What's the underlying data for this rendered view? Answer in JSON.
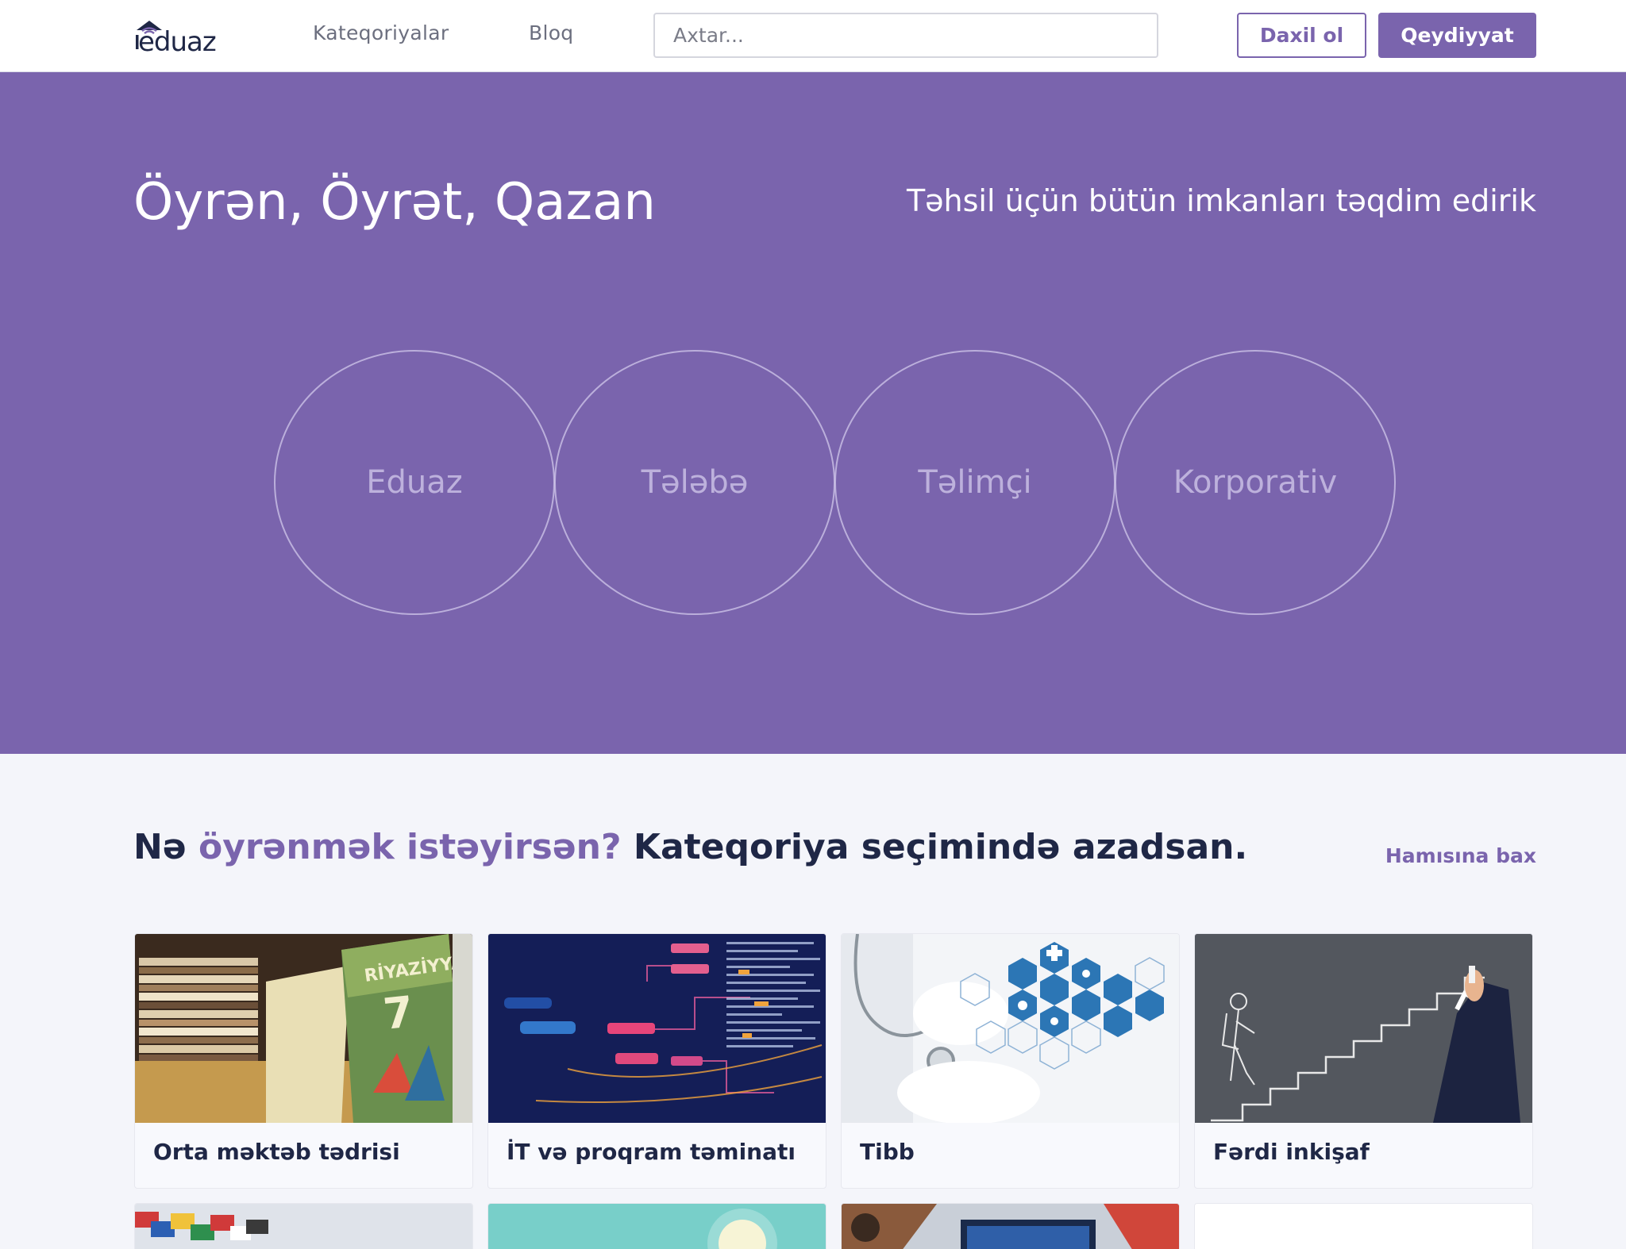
{
  "header": {
    "logo_text": "eduaz",
    "nav": {
      "categories": "Kateqoriyalar",
      "blog": "Bloq"
    },
    "search": {
      "placeholder": "Axtar..."
    },
    "login_label": "Daxil ol",
    "register_label": "Qeydiyyat"
  },
  "hero": {
    "title": "Öyrən, Öyrət, Qazan",
    "subtitle": "Təhsil üçün bütün imkanları təqdim edirik",
    "circles": [
      "Eduaz",
      "Tələbə",
      "Təlimçi",
      "Korporativ"
    ]
  },
  "categories": {
    "heading_part1": "Nə ",
    "heading_accent": "öyrənmək istəyirsən?",
    "heading_part2": " Kateqoriya seçimində azadsan.",
    "see_all": "Hamısına bax",
    "cards": [
      {
        "label": "Orta məktəb tədrisi"
      },
      {
        "label": "İT və proqram təminatı"
      },
      {
        "label": "Tibb"
      },
      {
        "label": "Fərdi inkişaf"
      }
    ]
  },
  "colors": {
    "brand": "#7a64ad",
    "heading": "#1f2746",
    "page_background": "#f4f5fa"
  },
  "icons": [
    "graduation-cap-icon"
  ]
}
